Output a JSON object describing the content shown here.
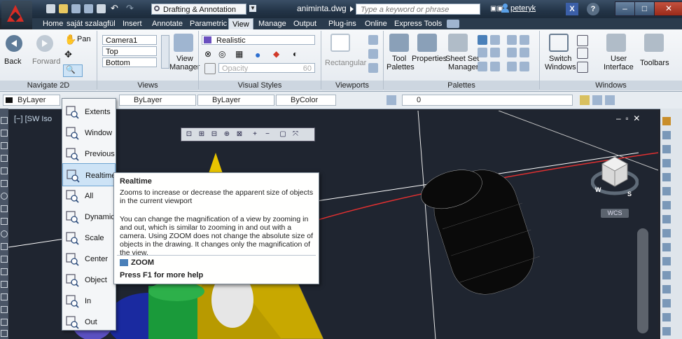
{
  "title_bar": {
    "workspace": "Drafting & Annotation",
    "filename": "animinta.dwg",
    "search_placeholder": "Type a keyword or phrase",
    "username": "peteryk"
  },
  "tabs": [
    "Home",
    "saját szalagfül",
    "Insert",
    "Annotate",
    "Parametric",
    "View",
    "Manage",
    "Output",
    "Plug-ins",
    "Online",
    "Express Tools"
  ],
  "active_tab": "View",
  "ribbon": {
    "navigate": {
      "back": "Back",
      "forward": "Forward",
      "pan": "Pan",
      "title": "Navigate 2D"
    },
    "views": {
      "items": [
        "Camera1",
        "Top",
        "Bottom"
      ],
      "manager": [
        "View",
        "Manager"
      ],
      "title": "Views"
    },
    "visual_styles": {
      "style": "Realistic",
      "opacity_label": "Opacity",
      "opacity_value": "60",
      "title": "Visual Styles"
    },
    "viewports": {
      "rectangular": "Rectangular",
      "title": "Viewports"
    },
    "palettes": {
      "tool": [
        "Tool",
        "Palettes"
      ],
      "properties": "Properties",
      "sheet_set": [
        "Sheet Set",
        "Manager"
      ],
      "title": "Palettes"
    },
    "windows": {
      "switch": [
        "Switch",
        "Windows"
      ],
      "user_interface": [
        "User",
        "Interface"
      ],
      "toolbars": "Toolbars",
      "title": "Windows"
    }
  },
  "properties_bar": {
    "layer": "ByLayer",
    "color": "ByLayer",
    "linetype": "ByLayer",
    "lineweight": "ByColor",
    "layer_state": "0"
  },
  "viewport": {
    "label": "[−] [SW Iso",
    "wcs": "WCS",
    "compass": {
      "n": "N",
      "s": "S",
      "w": "W",
      "e": "E"
    }
  },
  "zoom_menu": [
    {
      "label": "Extents",
      "icon": "zoom-extents-icon"
    },
    {
      "label": "Window",
      "icon": "zoom-window-icon"
    },
    {
      "label": "Previous",
      "icon": "zoom-previous-icon"
    },
    {
      "label": "Realtime",
      "icon": "zoom-realtime-icon",
      "selected": true
    },
    {
      "label": "All",
      "icon": "zoom-all-icon"
    },
    {
      "label": "Dynamic",
      "icon": "zoom-dynamic-icon"
    },
    {
      "label": "Scale",
      "icon": "zoom-scale-icon"
    },
    {
      "label": "Center",
      "icon": "zoom-center-icon"
    },
    {
      "label": "Object",
      "icon": "zoom-object-icon"
    },
    {
      "label": "In",
      "icon": "zoom-in-icon"
    },
    {
      "label": "Out",
      "icon": "zoom-out-icon"
    }
  ],
  "tooltip": {
    "title": "Realtime",
    "short": "Zooms to increase or decrease the apparent size of objects in the current viewport",
    "long": "You can change the magnification of a view by zooming in and out, which is similar to zooming in and out with a camera. Using ZOOM does not change the absolute size of objects in the drawing. It changes only the magnification of the view.",
    "command": "ZOOM",
    "help": "Press F1 for more help"
  },
  "colors": {
    "accent": "#d72c24",
    "title_bar": "#233447",
    "ribbon": "#e9eef3",
    "selection": "#cde3f6"
  }
}
